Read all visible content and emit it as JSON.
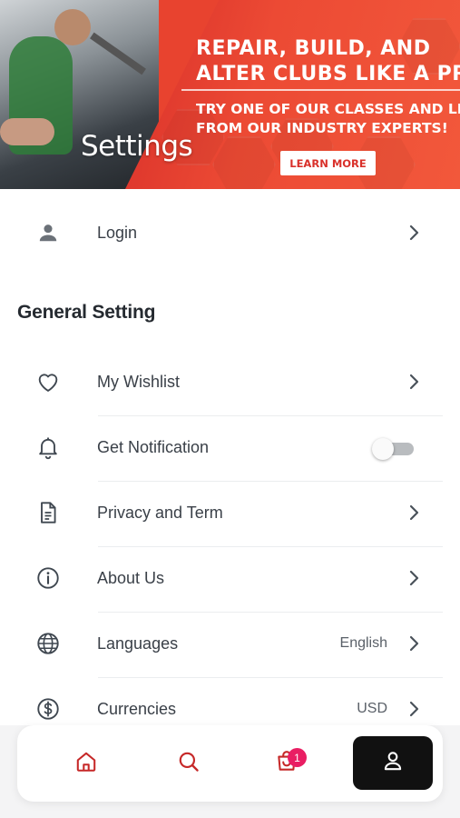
{
  "banner": {
    "headline_line1": "REPAIR, BUILD, AND",
    "headline_line2": "ALTER CLUBS LIKE A PRO",
    "sub_line1": "TRY ONE OF OUR CLASSES AND LEARN",
    "sub_line2": "FROM OUR INDUSTRY EXPERTS!",
    "button_label": "LEARN MORE"
  },
  "page_title": "Settings",
  "account": {
    "login_label": "Login",
    "icon": "person-icon"
  },
  "general": {
    "section_title": "General Setting",
    "items": [
      {
        "label": "My Wishlist",
        "icon": "heart-icon",
        "type": "link"
      },
      {
        "label": "Get Notification",
        "icon": "bell-icon",
        "type": "toggle",
        "enabled": false
      },
      {
        "label": "Privacy and Term",
        "icon": "document-icon",
        "type": "link"
      },
      {
        "label": "About Us",
        "icon": "info-icon",
        "type": "link"
      },
      {
        "label": "Languages",
        "icon": "globe-icon",
        "type": "link",
        "value": "English"
      },
      {
        "label": "Currencies",
        "icon": "dollar-icon",
        "type": "link",
        "value": "USD"
      }
    ]
  },
  "bottom_nav": {
    "items": [
      {
        "name": "home",
        "icon": "home-icon"
      },
      {
        "name": "search",
        "icon": "search-icon"
      },
      {
        "name": "cart",
        "icon": "cart-icon"
      },
      {
        "name": "account",
        "icon": "user-icon",
        "active": true
      }
    ],
    "cart_badge": "1"
  },
  "colors": {
    "accent": "#d32f2f",
    "banner_red": "#ec4a34",
    "badge": "#e91e63",
    "active_tab": "#111111",
    "icon_gray": "#3f4750"
  }
}
